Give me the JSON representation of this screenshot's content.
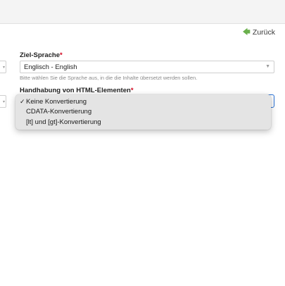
{
  "header": {
    "back_label": "Zurück",
    "back_icon": "arrow-left-icon"
  },
  "target_language": {
    "label": "Ziel-Sprache",
    "required_mark": "*",
    "value": "Englisch - English",
    "help": "Bitte wählen Sie die Sprache aus, in die die Inhalte übersetzt werden sollen."
  },
  "html_handling": {
    "label": "Handhabung von HTML-Elementen",
    "required_mark": "*",
    "check_mark": "✓",
    "options": [
      {
        "label": "Keine Konvertierung",
        "selected": true
      },
      {
        "label": "CDATA-Konvertierung",
        "selected": false
      },
      {
        "label": "[lt] und [gt]-Konvertierung",
        "selected": false
      }
    ]
  },
  "colors": {
    "accent_green": "#6ab04c",
    "focus_blue": "#2a72d6",
    "required_red": "#d0021b"
  }
}
